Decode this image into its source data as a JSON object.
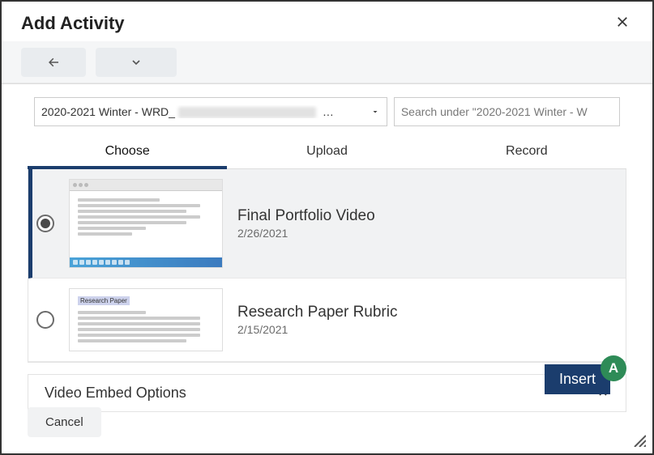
{
  "dialog": {
    "title": "Add Activity",
    "close_label": "Close"
  },
  "toolbar": {
    "back_label": "Back",
    "more_label": "More"
  },
  "course_selector": {
    "prefix": "2020-2021 Winter - WRD_",
    "suffix": " …"
  },
  "search": {
    "placeholder": "Search under \"2020-2021 Winter - W"
  },
  "tabs": {
    "choose": "Choose",
    "upload": "Upload",
    "record": "Record",
    "active": "choose"
  },
  "items": [
    {
      "title": "Final Portfolio Video",
      "date": "2/26/2021",
      "selected": true
    },
    {
      "title": "Research Paper Rubric",
      "date": "2/15/2021",
      "selected": false
    }
  ],
  "thumbnail_labels": {
    "research_paper": "Research Paper"
  },
  "accordion": {
    "title": "Video Embed Options"
  },
  "actions": {
    "insert": "Insert",
    "cancel": "Cancel"
  },
  "badge": {
    "letter": "A"
  }
}
